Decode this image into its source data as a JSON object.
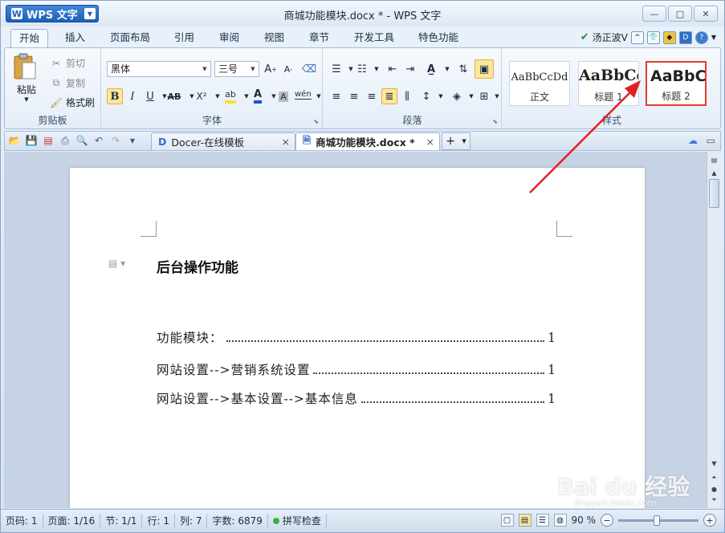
{
  "app": {
    "menu_button": "WPS 文字",
    "window_title": "商城功能模块.docx * - WPS 文字"
  },
  "window_controls": {
    "minimize": "—",
    "maximize": "□",
    "close": "✕"
  },
  "menu_tabs": [
    "开始",
    "插入",
    "页面布局",
    "引用",
    "审阅",
    "视图",
    "章节",
    "开发工具",
    "特色功能"
  ],
  "user": {
    "name": "汤正波V"
  },
  "ribbon": {
    "clipboard": {
      "paste": "粘贴",
      "cut": "剪切",
      "copy": "复制",
      "format_painter": "格式刷",
      "group_label": "剪贴板"
    },
    "font": {
      "font_name": "黑体",
      "font_size": "三号",
      "group_label": "字体",
      "bold": "B",
      "italic": "I",
      "underline": "U",
      "strike": "AB",
      "superscript": "X²",
      "font_color": "A",
      "char_shade": "A",
      "phonetic": "wén"
    },
    "paragraph": {
      "group_label": "段落"
    },
    "styles": {
      "group_label": "样式",
      "items": [
        {
          "sample": "AaBbCcDd",
          "name": "正文"
        },
        {
          "sample": "AaBbCc",
          "name": "标题 1"
        },
        {
          "sample": "AaBbC",
          "name": "标题 2"
        }
      ]
    }
  },
  "doc_tabs": [
    {
      "label": "Docer-在线模板",
      "close": "×"
    },
    {
      "label": "商城功能模块.docx *",
      "close": "×"
    }
  ],
  "new_tab": "+",
  "document": {
    "heading": "后台操作功能",
    "toc": [
      {
        "text": "功能模块：",
        "page": "1"
      },
      {
        "text": "网站设置-->营销系统设置",
        "page": "1"
      },
      {
        "text": "网站设置-->基本设置-->基本信息",
        "page": "1"
      }
    ]
  },
  "status": {
    "page_num": "页码: 1",
    "page": "页面: 1/16",
    "section": "节: 1/1",
    "row": "行: 1",
    "col": "列: 7",
    "words": "字数: 6879",
    "spell": "拼写检查",
    "zoom": "90 %"
  },
  "watermark": {
    "text": "Bai du 经验",
    "sub": "jingyan.baidu.com"
  },
  "colors": {
    "accent": "#1d5fb8",
    "annotation_arrow": "#e02020"
  }
}
